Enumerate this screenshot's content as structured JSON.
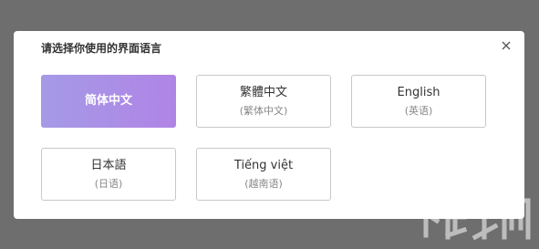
{
  "dialog": {
    "title": "请选择你使用的界面语言",
    "close_icon": "close-icon",
    "options": [
      {
        "label": "简体中文",
        "sub": "",
        "selected": true
      },
      {
        "label": "繁體中文",
        "sub": "(繁体中文)",
        "selected": false
      },
      {
        "label": "English",
        "sub": "(英语)",
        "selected": false
      },
      {
        "label": "日本語",
        "sub": "(日语)",
        "selected": false
      },
      {
        "label": "Tiếng việt",
        "sub": "(越南语)",
        "selected": false
      }
    ]
  },
  "colors": {
    "backdrop": "#6e6e6e",
    "selected_gradient_start": "#a59ae6",
    "selected_gradient_end": "#b084e6",
    "border": "#c8c8c8"
  }
}
